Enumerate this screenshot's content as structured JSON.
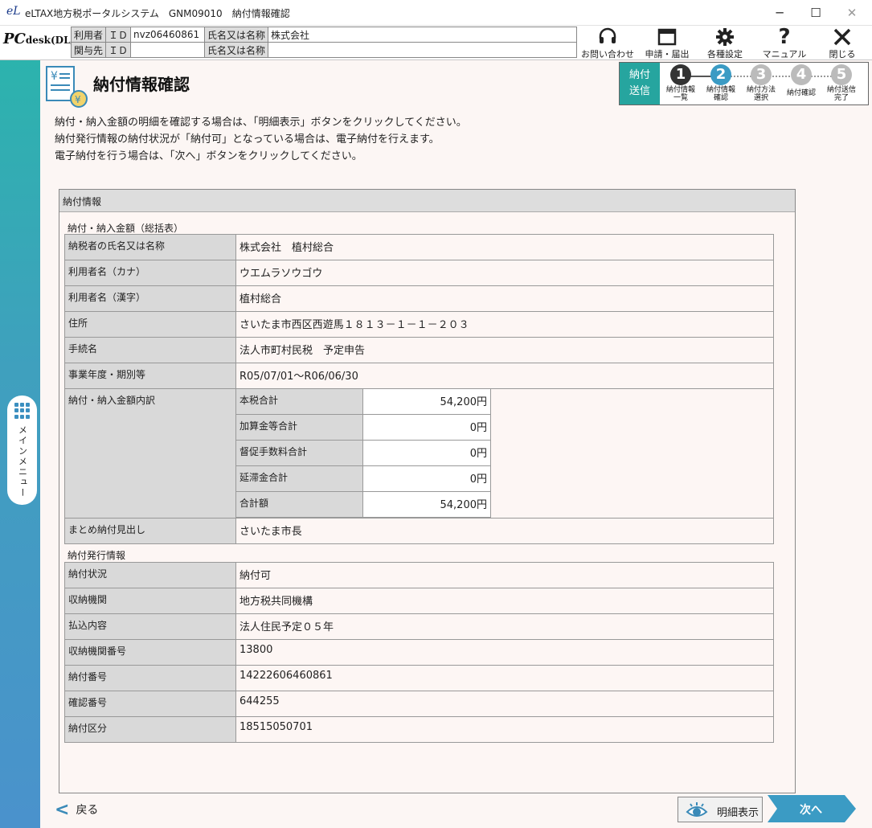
{
  "window": {
    "logo": "eL",
    "title": "eLTAX地方税ポータルシステム　GNM09010　納付情報確認",
    "minimize": "─",
    "maximize": "☐",
    "close": "✕"
  },
  "header": {
    "product": "PC",
    "product_sub": "desk",
    "product_edition": "(DL版)",
    "user_label": "利用者",
    "user_id_label": "ＩＤ",
    "user_id": "nvz06460861",
    "user_name_label": "氏名又は名称",
    "user_name": "株式会社",
    "assoc_label": "関与先",
    "assoc_id_label": "ＩＤ",
    "assoc_id": "",
    "assoc_name_label": "氏名又は名称",
    "assoc_name": "",
    "buttons": {
      "contact": "お問い合わせ",
      "apply": "申請・届出",
      "settings": "各種設定",
      "manual": "マニュアル",
      "close": "閉じる"
    }
  },
  "sidebar": {
    "main_menu": "メインメニュー"
  },
  "page": {
    "title": "納付情報確認",
    "description": [
      "納付・納入金額の明細を確認する場合は、「明細表示」ボタンをクリックしてください。",
      "納付発行情報の納付状況が「納付可」となっている場合は、電子納付を行えます。",
      "電子納付を行う場合は、「次へ」ボタンをクリックしてください。"
    ]
  },
  "steps": {
    "send_line1": "納付",
    "send_line2": "送信",
    "items": [
      {
        "num": "1",
        "l1": "納付情報",
        "l2": "一覧",
        "color": "#333333"
      },
      {
        "num": "2",
        "l1": "納付情報",
        "l2": "確認",
        "color": "#3b9bc4"
      },
      {
        "num": "3",
        "l1": "納付方法",
        "l2": "選択",
        "color": "#bbbbbb"
      },
      {
        "num": "4",
        "l1": "納付確認",
        "l2": "",
        "color": "#bbbbbb"
      },
      {
        "num": "5",
        "l1": "納付送信",
        "l2": "完了",
        "color": "#bbbbbb"
      }
    ]
  },
  "panel": {
    "heading": "納付情報",
    "summary_title": "納付・納入金額（総括表）",
    "rows": [
      {
        "label": "納税者の氏名又は名称",
        "value": "株式会社　植村総合"
      },
      {
        "label": "利用者名（カナ）",
        "value": "ウエムラソウゴウ"
      },
      {
        "label": "利用者名（漢字）",
        "value": "植村総合"
      },
      {
        "label": "住所",
        "value": "さいたま市西区西遊馬１８１３－１－１－２０３"
      },
      {
        "label": "手続名",
        "value": "法人市町村民税　予定申告"
      },
      {
        "label": "事業年度・期別等",
        "value": "R05/07/01～R06/06/30"
      }
    ],
    "breakdown_label": "納付・納入金額内訳",
    "breakdown": [
      {
        "label": "本税合計",
        "value": "54,200円"
      },
      {
        "label": "加算金等合計",
        "value": "0円"
      },
      {
        "label": "督促手数料合計",
        "value": "0円"
      },
      {
        "label": "延滞金合計",
        "value": "0円"
      },
      {
        "label": "合計額",
        "value": "54,200円"
      }
    ],
    "headline_label": "まとめ納付見出し",
    "headline_value": "さいたま市長",
    "issue_title": "納付発行情報",
    "issue_rows": [
      {
        "label": "納付状況",
        "value": "納付可"
      },
      {
        "label": "収納機関",
        "value": "地方税共同機構"
      },
      {
        "label": "払込内容",
        "value": "法人住民予定０５年"
      },
      {
        "label": "収納機関番号",
        "value": "13800"
      },
      {
        "label": "納付番号",
        "value": "14222606460861"
      },
      {
        "label": "確認番号",
        "value": "644255"
      },
      {
        "label": "納付区分",
        "value": "18515050701"
      }
    ]
  },
  "footer": {
    "back": "戻る",
    "detail": "明細表示",
    "next": "次へ"
  },
  "colors": {
    "accent": "#26a59f",
    "next": "#3b9bc4"
  }
}
